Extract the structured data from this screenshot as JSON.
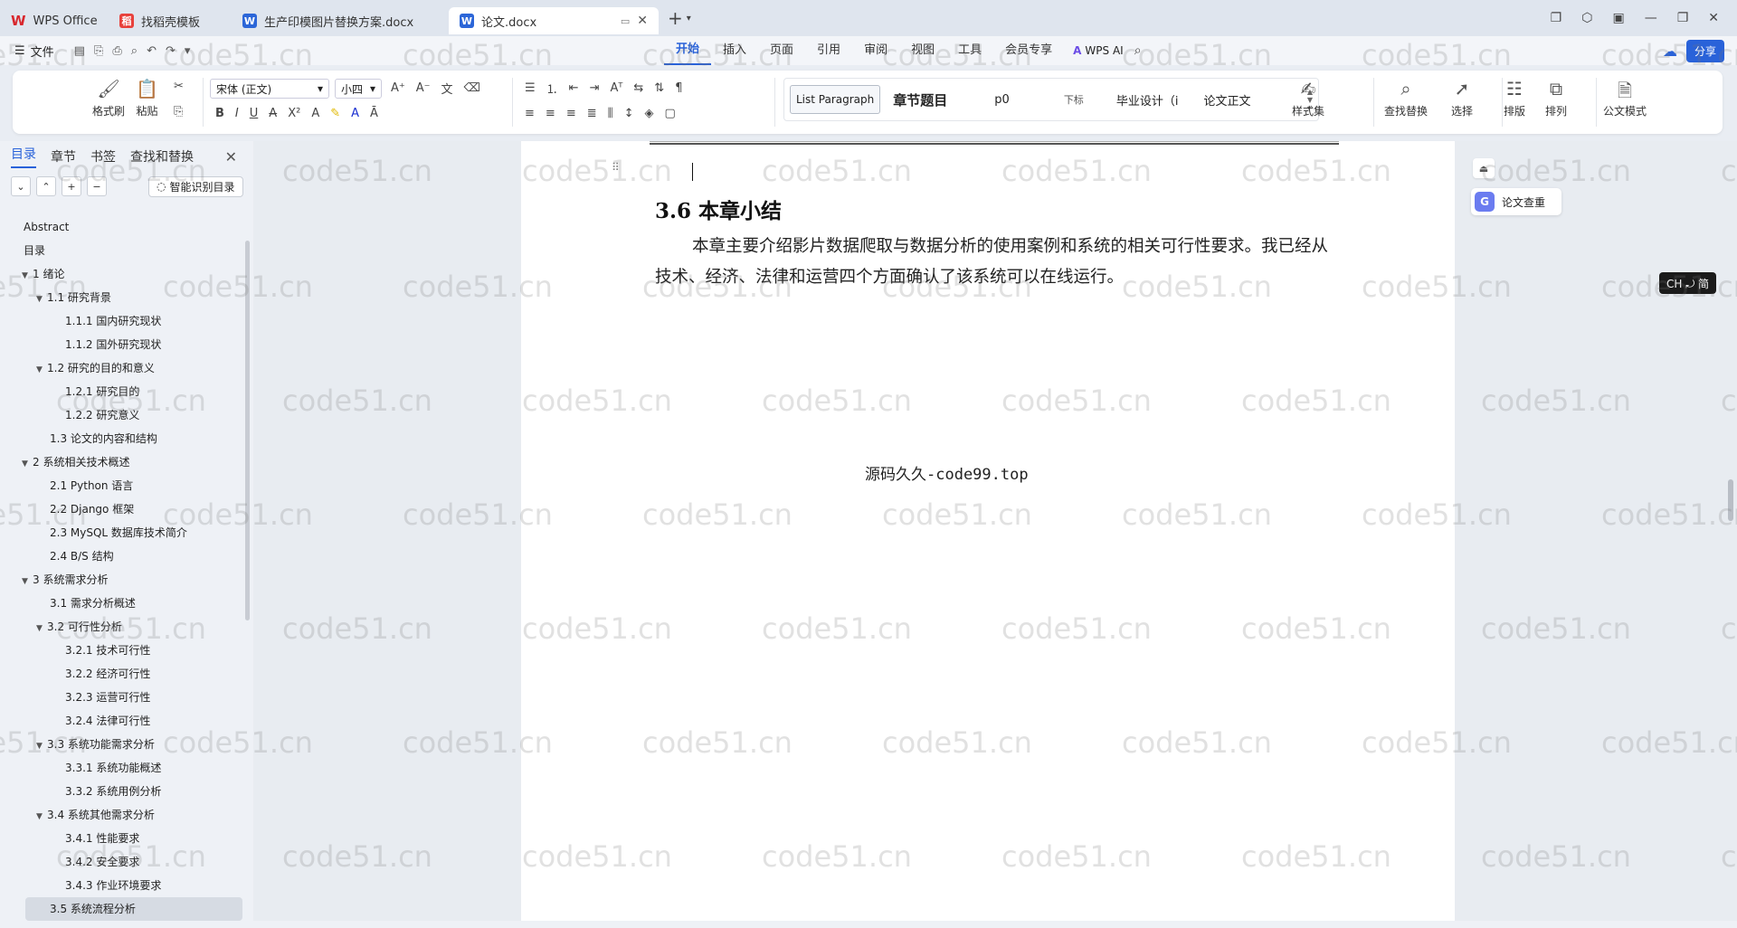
{
  "titlebar": {
    "tabs": [
      {
        "label": "WPS Office",
        "icon": "wps-logo"
      },
      {
        "label": "找稻壳模板",
        "icon": "docer-icon"
      },
      {
        "label": "生产印模图片替换方案.docx",
        "icon": "word-doc-icon"
      },
      {
        "label": "论文.docx",
        "icon": "word-doc-icon",
        "active": true
      }
    ]
  },
  "menubar": {
    "file_label": "文件",
    "tabs": [
      "开始",
      "插入",
      "页面",
      "引用",
      "审阅",
      "视图",
      "工具",
      "会员专享"
    ],
    "active_tab": "开始",
    "ai_label": "WPS AI",
    "share_label": "分享"
  },
  "ribbon": {
    "format_painter": "格式刷",
    "paste": "粘贴",
    "font_name": "宋体 (正文)",
    "font_size": "小四",
    "styles": [
      "List Paragraph",
      "章节题目",
      "p0",
      "下标",
      "毕业设计（i",
      "论文正文"
    ],
    "style_set": "样式集",
    "find_replace": "查找替换",
    "select": "选择",
    "layout": "排版",
    "arrange": "排列",
    "official": "公文模式"
  },
  "nav": {
    "tabs": [
      "目录",
      "章节",
      "书签",
      "查找和替换"
    ],
    "active_tab": "目录",
    "smart_toc": "智能识别目录",
    "items": [
      {
        "label": "Abstract",
        "level": "l0"
      },
      {
        "label": "目录",
        "level": "l0"
      },
      {
        "label": "1 绪论",
        "level": "l0c"
      },
      {
        "label": "1.1 研究背景",
        "level": "l1c"
      },
      {
        "label": "1.1.1 国内研究现状",
        "level": "l2"
      },
      {
        "label": "1.1.2 国外研究现状",
        "level": "l2"
      },
      {
        "label": "1.2 研究的目的和意义",
        "level": "l1c"
      },
      {
        "label": "1.2.1 研究目的",
        "level": "l2"
      },
      {
        "label": "1.2.2  研究意义",
        "level": "l2"
      },
      {
        "label": "1.3  论文的内容和结构",
        "level": "l1plain"
      },
      {
        "label": "2 系统相关技术概述",
        "level": "l0c"
      },
      {
        "label": "2.1 Python 语言",
        "level": "l1plain"
      },
      {
        "label": "2.2 Django 框架",
        "level": "l1plain"
      },
      {
        "label": "2.3 MySQL 数据库技术简介",
        "level": "l1plain"
      },
      {
        "label": "2.4 B/S 结构",
        "level": "l1plain"
      },
      {
        "label": "3 系统需求分析",
        "level": "l0c"
      },
      {
        "label": "3.1 需求分析概述",
        "level": "l1plain"
      },
      {
        "label": "3.2 可行性分析",
        "level": "l1c"
      },
      {
        "label": "3.2.1 技术可行性",
        "level": "l2"
      },
      {
        "label": "3.2.2 经济可行性",
        "level": "l2"
      },
      {
        "label": "3.2.3 运营可行性",
        "level": "l2"
      },
      {
        "label": "3.2.4 法律可行性",
        "level": "l2"
      },
      {
        "label": "3.3 系统功能需求分析",
        "level": "l1c"
      },
      {
        "label": "3.3.1 系统功能概述",
        "level": "l2"
      },
      {
        "label": "3.3.2 系统用例分析",
        "level": "l2"
      },
      {
        "label": "3.4 系统其他需求分析",
        "level": "l1c"
      },
      {
        "label": "3.4.1 性能要求",
        "level": "l2"
      },
      {
        "label": "3.4.2 安全要求",
        "level": "l2"
      },
      {
        "label": "3.4.3 作业环境要求",
        "level": "l2"
      },
      {
        "label": "3.5 系统流程分析",
        "level": "cur"
      }
    ]
  },
  "document": {
    "heading": "3.6 本章小结",
    "paragraph": "本章主要介绍影片数据爬取与数据分析的使用案例和系统的相关可行性要求。我已经从技术、经济、法律和运营四个方面确认了该系统可以在线运行。",
    "footer_mark": "源码久久-code99.top"
  },
  "right_tools": {
    "paper_check": "论文查重",
    "ime": "CH ⤾ 简"
  },
  "watermark": "code51.cn"
}
